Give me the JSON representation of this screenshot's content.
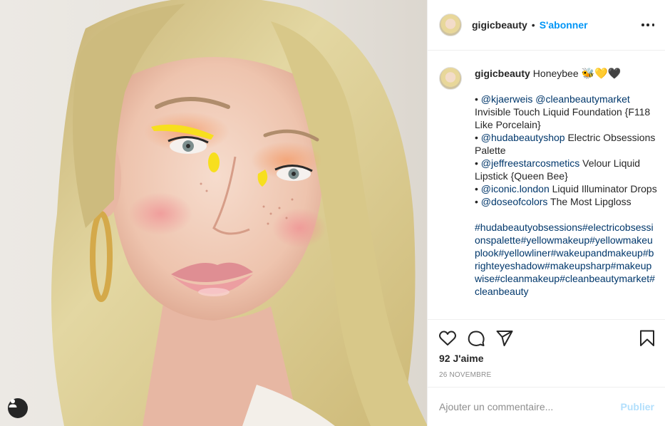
{
  "post": {
    "username": "gigicbeauty",
    "dot": "•",
    "follow_label": "S'abonner",
    "more_icon": "more-horizontal-icon"
  },
  "caption": {
    "username": "gigicbeauty",
    "title": "Honeybee",
    "emojis": "🐝💛🖤",
    "lines": [
      {
        "bullet": "• ",
        "mentions": [
          "@kjaerweis",
          "@cleanbeautymarket"
        ],
        "text": "Invisible Touch Liquid Foundation {F118 Like Porcelain}"
      },
      {
        "bullet": "• ",
        "mentions": [
          "@hudabeautyshop"
        ],
        "text": "Electric Obsessions Palette"
      },
      {
        "bullet": "• ",
        "mentions": [
          "@jeffreestarcosmetics"
        ],
        "text": "Velour Liquid Lipstick {Queen Bee}"
      },
      {
        "bullet": "• ",
        "mentions": [
          "@iconic.london"
        ],
        "text": "Liquid Illuminator Drops"
      },
      {
        "bullet": "• ",
        "mentions": [
          "@doseofcolors"
        ],
        "text": "The Most Lipgloss"
      }
    ],
    "hashtags": "#hudabeautyobsessions#electricobsessionspalette#yellowmakeup#yellowmakeuplook#yellowliner#wakeupandmakeup#brighteyeshadow#makeupsharp#makeupwise#cleanmakeup#cleanbeautymarket#cleanbeauty"
  },
  "actions": {
    "like_icon": "heart-icon",
    "comment_icon": "comment-icon",
    "share_icon": "paper-plane-icon",
    "save_icon": "bookmark-icon"
  },
  "likes_label": "92 J'aime",
  "date_label": "26 NOVEMBRE",
  "comment": {
    "placeholder": "Ajouter un commentaire...",
    "value": "",
    "publish_label": "Publier"
  },
  "media": {
    "tag_icon": "user-tag-icon",
    "colors": {
      "hair": "#d9cc8f",
      "skin": "#f2d2c0",
      "eyeliner": "#f7df1e",
      "lips": "#e8979a",
      "background": "#e9e6e0"
    }
  }
}
